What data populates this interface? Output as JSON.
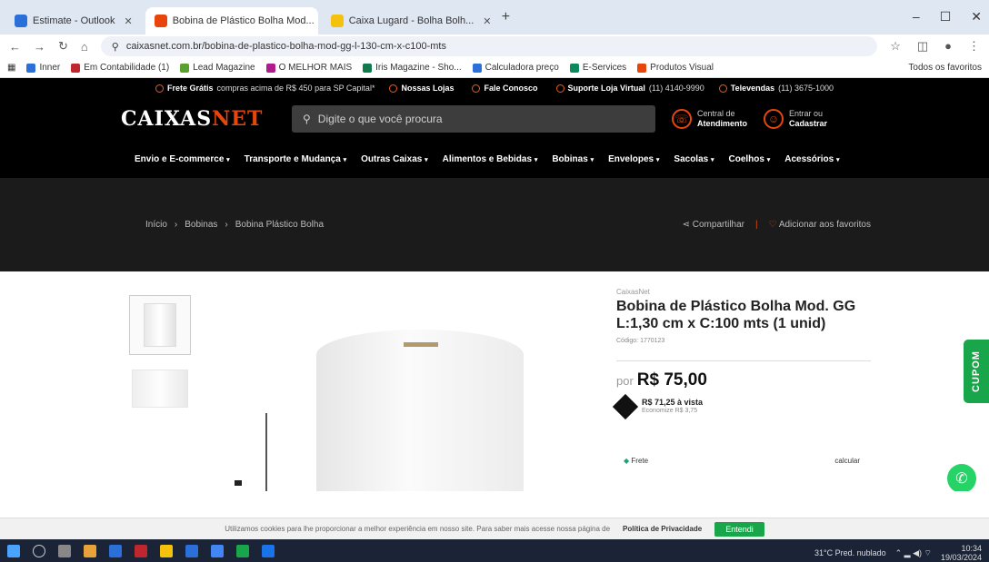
{
  "browser": {
    "tabs": [
      {
        "label": "Estimate - Outlook",
        "color": "#2b6fd8",
        "active": false
      },
      {
        "label": "Bobina de Plástico Bolha Mod...",
        "color": "#e8450c",
        "active": true
      },
      {
        "label": "Caixa Lugard - Bolha Bolh...",
        "color": "#f4c20d",
        "active": false
      }
    ],
    "new_tab": "+",
    "window_controls": [
      "–",
      "☐",
      "✕"
    ],
    "url": "caixasnet.com.br/bobina-de-plastico-bolha-mod-gg-l-130-cm-x-c100-mts",
    "bookmarks": [
      {
        "label": "Inner",
        "color": "#2b6fd8"
      },
      {
        "label": "Em Contabilidade (1)",
        "color": "#c0262e"
      },
      {
        "label": "Lead Magazine",
        "color": "#5aa02c"
      },
      {
        "label": "O MELHOR MAIS",
        "color": "#b01c8d"
      },
      {
        "label": "Iris Magazine - Sho...",
        "color": "#0f7a4b"
      },
      {
        "label": "Calculadora preço",
        "color": "#2b6fd8"
      },
      {
        "label": "E-Services",
        "color": "#0a8a5d"
      },
      {
        "label": "Produtos Visual",
        "color": "#e8450c"
      }
    ],
    "bookmarks_other": "Todos os favoritos"
  },
  "site": {
    "topbar": [
      {
        "bold": "Frete Grátis",
        "text": "compras acima de R$ 450 para SP Capital*"
      },
      {
        "bold": "Nossas Lojas",
        "text": ""
      },
      {
        "bold": "Fale Conosco",
        "text": ""
      },
      {
        "bold": "Suporte Loja Virtual",
        "text": "(11) 4140-9990"
      },
      {
        "bold": "Televendas",
        "text": "(11) 3675-1000"
      }
    ],
    "logo_main": "CAIXAS",
    "logo_accent": "NET",
    "search_placeholder": "Digite o que você procura",
    "header_actions": [
      {
        "line1": "Central de",
        "line2": "Atendimento",
        "icon": "headset-icon"
      },
      {
        "line1": "Entrar ou",
        "line2": "Cadastrar",
        "icon": "user-icon"
      }
    ],
    "categories": [
      "Envio e E-commerce",
      "Transporte e Mudança",
      "Outras Caixas",
      "Alimentos e Bebidas",
      "Bobinas",
      "Envelopes",
      "Sacolas",
      "Coelhos",
      "Acessórios"
    ],
    "breadcrumb": [
      "Início",
      "Bobinas",
      "Bobina Plástico Bolha"
    ],
    "share_label": "Compartilhar",
    "favorite_label": "Adicionar aos favoritos"
  },
  "product": {
    "brand": "CaixasNet",
    "title": "Bobina de Plástico Bolha Mod. GG L:1,30 cm x C:100 mts (1 unid)",
    "code": "Código: 1770123",
    "price_prefix": "por",
    "price": "R$ 75,00",
    "pix_price": "R$ 71,25 à vista",
    "pix_note": "Economize R$ 3,75",
    "shipping_label": "Frete",
    "shipping_right": "calcular"
  },
  "cupom_label": "CUPOM",
  "cookie": {
    "text": "Utilizamos cookies para lhe proporcionar a melhor experiência em nosso site. Para saber mais acesse nossa página de",
    "link": "Política de Privacidade",
    "button": "Entendi"
  },
  "taskbar": {
    "weather": "31°C Pred. nublado",
    "time": "10:34",
    "date": "19/03/2024"
  }
}
